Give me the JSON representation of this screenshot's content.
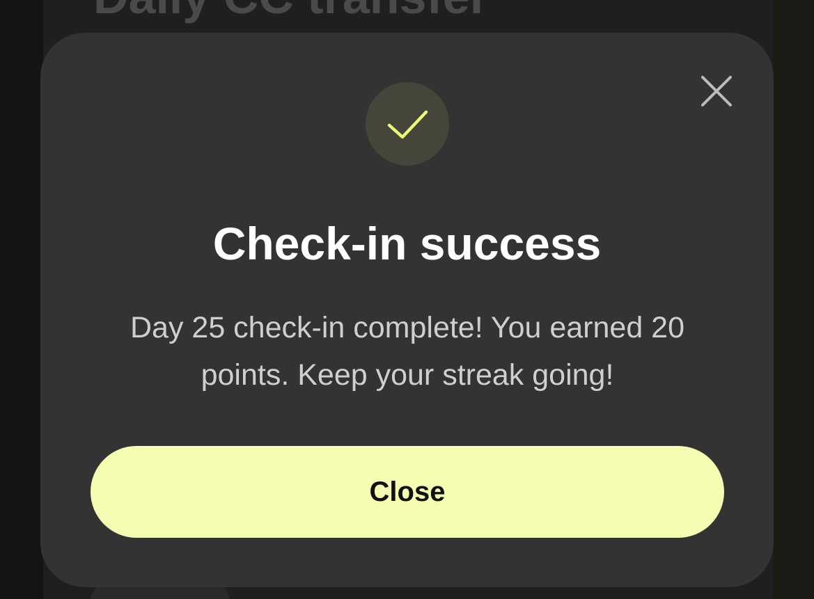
{
  "background": {
    "page_title": "Daily CC transfer"
  },
  "dialog": {
    "title": "Check-in success",
    "message": "Day 25 check-in complete! You earned 20 points. Keep your streak going!",
    "close_button_label": "Close",
    "success_icon": "checkmark-icon",
    "dismiss_icon": "close-icon"
  },
  "colors": {
    "accent": "#f4fdb1",
    "checkmark": "#eef77a",
    "modal_background": "#333333",
    "icon_circle": "#45453a"
  }
}
